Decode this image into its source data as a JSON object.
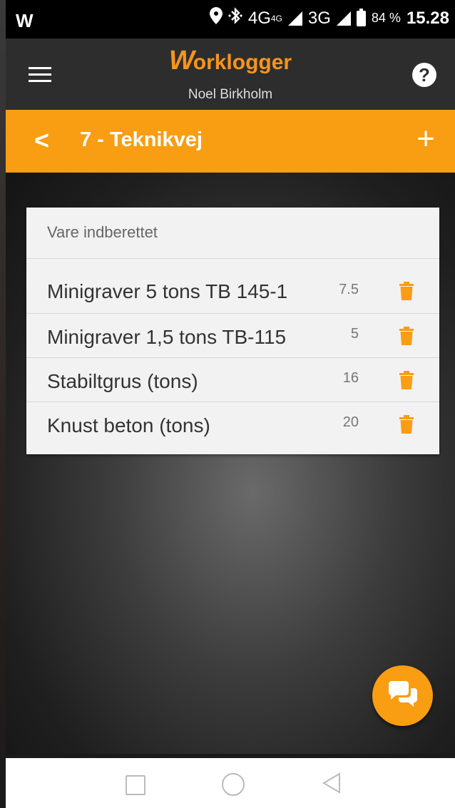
{
  "status_bar": {
    "battery": "84 %",
    "time": "15.28",
    "network1": "4G",
    "network1_badge": "4G",
    "network2": "3G"
  },
  "header": {
    "logo_mark": "W",
    "logo_text": "orklogger",
    "user_name": "Noel Birkholm",
    "help_label": "?"
  },
  "title_bar": {
    "back_label": "<",
    "title": "7 - Teknikvej",
    "add_label": "+"
  },
  "card": {
    "header": "Vare indberettet",
    "items": [
      {
        "name": "Minigraver 5 tons TB 145-1",
        "qty": "7.5"
      },
      {
        "name": "Minigraver 1,5 tons TB-115",
        "qty": "5"
      },
      {
        "name": "Stabiltgrus (tons)",
        "qty": "16"
      },
      {
        "name": "Knust beton (tons)",
        "qty": "20"
      }
    ]
  },
  "colors": {
    "accent": "#f99d12",
    "header_bg": "#2d2d2d",
    "card_bg": "#f2f2f2"
  },
  "icons": {
    "menu": "hamburger-icon",
    "help": "help-icon",
    "back": "chevron-left-icon",
    "add": "plus-icon",
    "delete": "trash-icon",
    "chat": "chat-icon"
  }
}
